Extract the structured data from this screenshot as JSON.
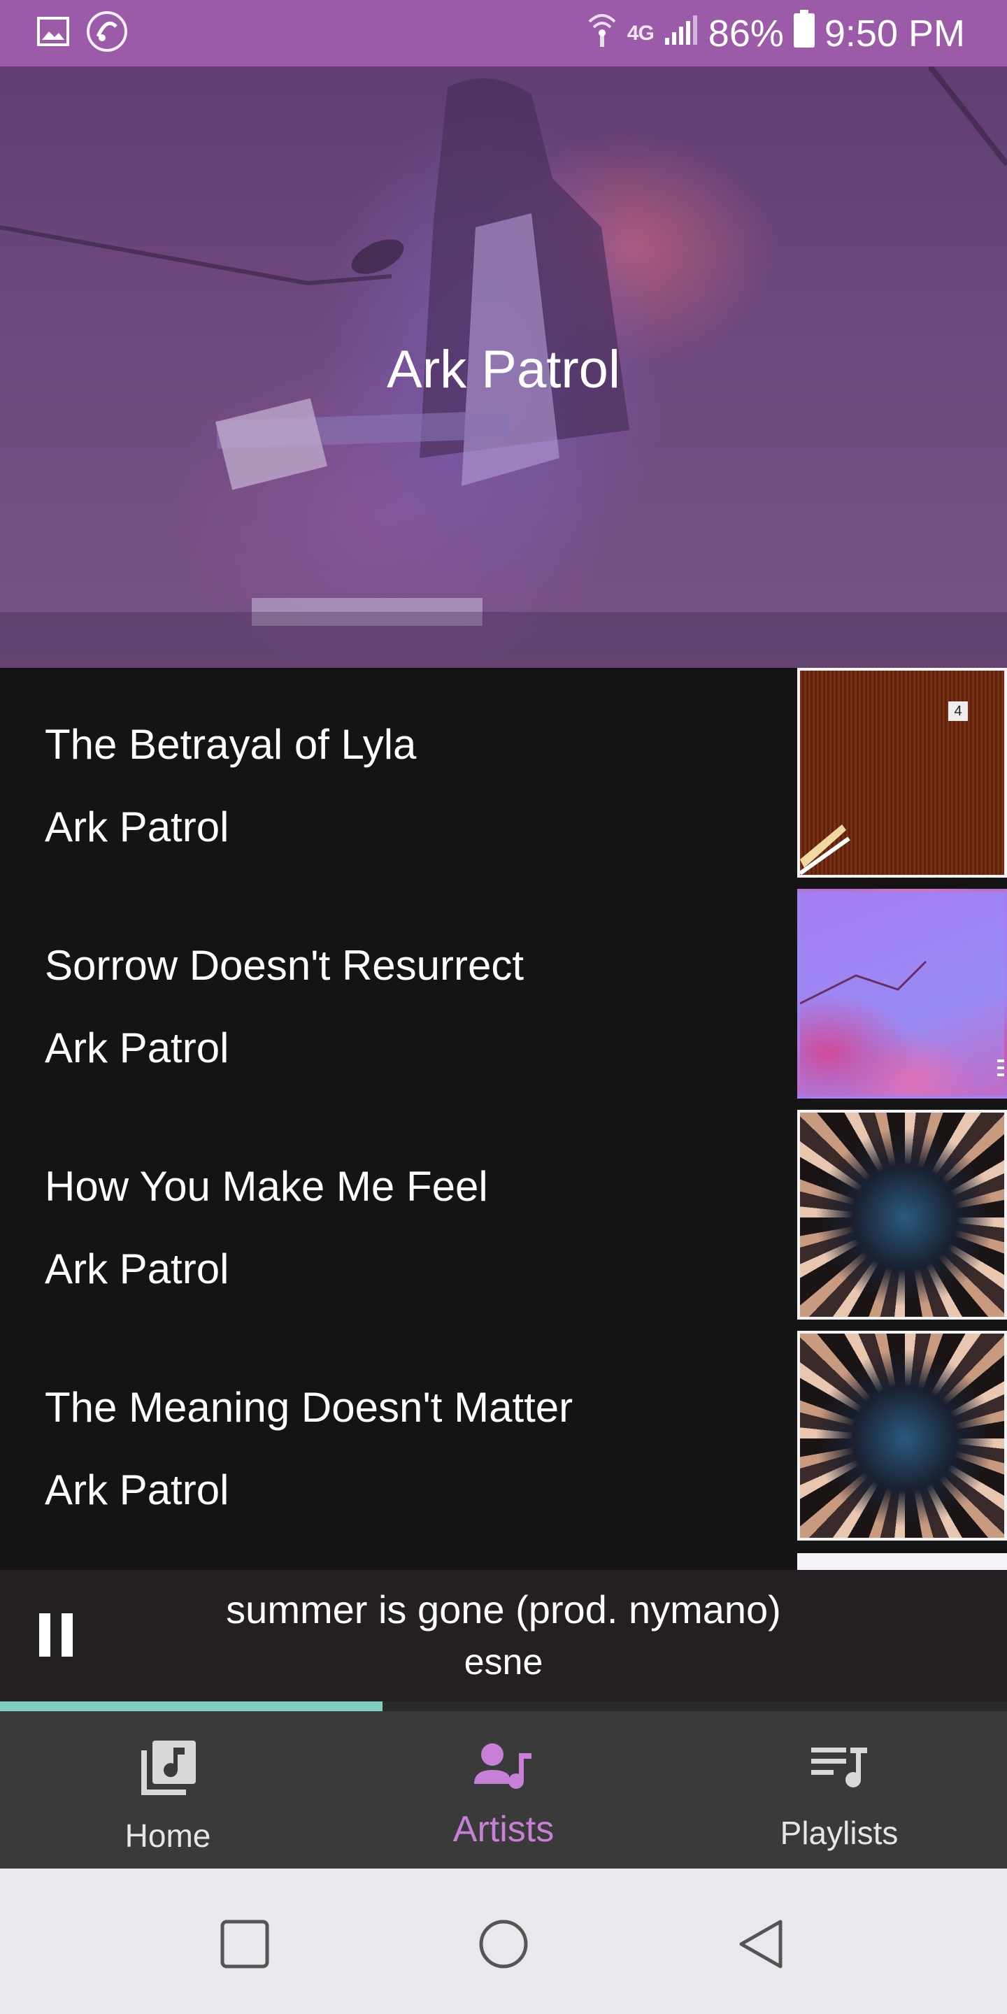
{
  "status_bar": {
    "network": "4G",
    "battery": "86%",
    "time": "9:50 PM"
  },
  "hero": {
    "artist_name": "Ark Patrol"
  },
  "tracks": [
    {
      "title": "The Betrayal of Lyla",
      "artist": "Ark Patrol",
      "art_badge": "4"
    },
    {
      "title": "Sorrow Doesn't Resurrect",
      "artist": "Ark Patrol"
    },
    {
      "title": "How You Make Me Feel",
      "artist": "Ark Patrol"
    },
    {
      "title": "The Meaning Doesn't Matter",
      "artist": "Ark Patrol"
    }
  ],
  "now_playing": {
    "title": "summer is gone (prod. nymano)",
    "artist": "esne",
    "progress": 0.38
  },
  "bottom_nav": {
    "items": [
      {
        "label": "Home",
        "icon": "music-library-icon"
      },
      {
        "label": "Artists",
        "icon": "artist-icon"
      },
      {
        "label": "Playlists",
        "icon": "playlist-icon"
      }
    ],
    "active": "Artists"
  },
  "colors": {
    "status_bar": "#9b5ba8",
    "accent": "#c780d6",
    "progress": "#7fcfbf",
    "nav_bg": "#3a3a3a",
    "player_bg": "#231f23",
    "list_bg": "#141414"
  }
}
